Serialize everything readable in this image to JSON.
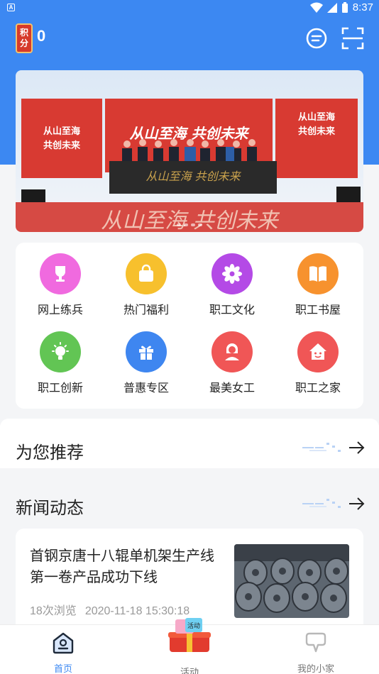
{
  "status_bar": {
    "app_badge": "A",
    "time": "8:37"
  },
  "header": {
    "points_badge": "积分",
    "points_value": "0"
  },
  "banner": {
    "slogan": "从山至海 共创未来",
    "side_slogan_1": "从山至海",
    "side_slogan_2": "共创未来",
    "dots": 4
  },
  "grid": [
    {
      "label": "网上练兵",
      "icon": "trophy-icon",
      "color": "#f06adf"
    },
    {
      "label": "热门福利",
      "icon": "shopping-bag-icon",
      "color": "#f7c02d"
    },
    {
      "label": "职工文化",
      "icon": "flower-icon",
      "color": "#b44ae6"
    },
    {
      "label": "职工书屋",
      "icon": "book-icon",
      "color": "#f7922e"
    },
    {
      "label": "职工创新",
      "icon": "lightbulb-icon",
      "color": "#62c554"
    },
    {
      "label": "普惠专区",
      "icon": "gift-icon",
      "color": "#3e86f0"
    },
    {
      "label": "最美女工",
      "icon": "woman-icon",
      "color": "#f05656"
    },
    {
      "label": "职工之家",
      "icon": "home-face-icon",
      "color": "#f05656"
    }
  ],
  "sections": {
    "recommend_title": "为您推荐",
    "news_title": "新闻动态"
  },
  "news": [
    {
      "title": "首钢京唐十八辊单机架生产线第一卷产品成功下线",
      "views": "18次浏览",
      "date": "2020-11-18 15:30:18"
    }
  ],
  "bottom_nav": {
    "home": "首页",
    "activity": "活动",
    "activity_badge": "活动",
    "mine": "我的小家"
  },
  "colors": {
    "primary": "#3c88f2",
    "banner_red": "#d83a32"
  }
}
